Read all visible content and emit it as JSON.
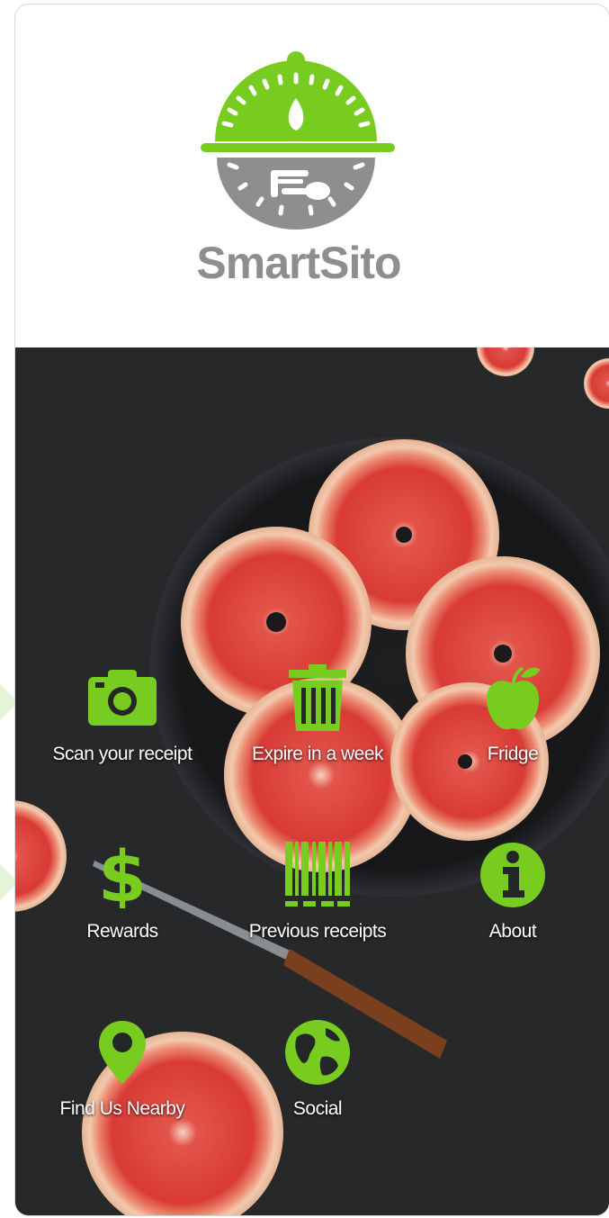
{
  "app": {
    "name": "SmartSito"
  },
  "colors": {
    "accent": "#77cc1f",
    "brand_gray": "#8e8e8e",
    "background": "#252628",
    "tile_text": "#ffffff"
  },
  "menu": [
    {
      "label": "Scan your receipt",
      "icon": "camera-icon"
    },
    {
      "label": "Expire in a week",
      "icon": "trash-icon"
    },
    {
      "label": "Fridge",
      "icon": "apple-icon"
    },
    {
      "label": "Rewards",
      "icon": "dollar-icon"
    },
    {
      "label": "Previous receipts",
      "icon": "barcode-icon"
    },
    {
      "label": "About",
      "icon": "info-icon"
    },
    {
      "label": "Find Us Nearby",
      "icon": "location-pin-icon"
    },
    {
      "label": "Social",
      "icon": "globe-icon"
    }
  ]
}
